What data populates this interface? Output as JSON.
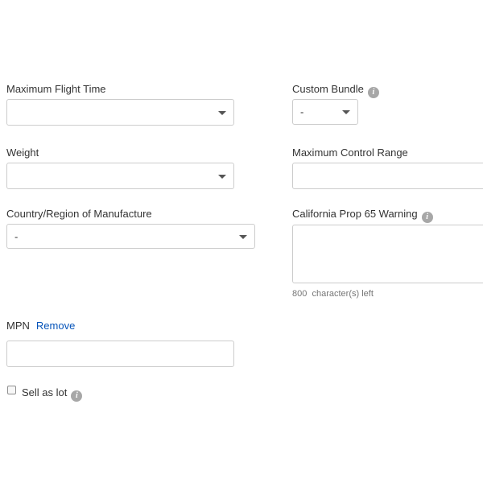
{
  "left_column": {
    "max_flight_time": {
      "label": "Maximum Flight Time",
      "value": ""
    },
    "weight": {
      "label": "Weight",
      "value": ""
    },
    "country_region": {
      "label": "Country/Region of Manufacture",
      "value": "-"
    },
    "mpn": {
      "label": "MPN",
      "remove_link": "Remove",
      "value": ""
    },
    "sell_as_lot": {
      "label": "Sell as lot",
      "checked": false
    }
  },
  "right_column": {
    "custom_bundle": {
      "label": "Custom Bundle",
      "value": "-"
    },
    "max_control_range": {
      "label": "Maximum Control Range",
      "value": ""
    },
    "prop65": {
      "label": "California Prop 65 Warning",
      "value": "",
      "chars_left": "800",
      "chars_left_suffix": "character(s) left"
    }
  },
  "icons": {
    "info": "info-icon",
    "dropdown": "chevron-down-icon"
  },
  "colors": {
    "link": "#0654ba",
    "border": "#cccccc",
    "info_icon": "#a7a7a7"
  }
}
